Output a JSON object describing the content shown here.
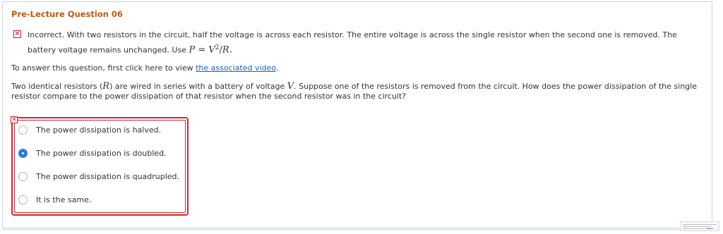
{
  "question": {
    "title": "Pre-Lecture Question 06",
    "feedback": {
      "icon": "x-mark-icon",
      "text_part1": "Incorrect. With two resistors in the circuit, half the voltage is across each resistor. The entire voltage is across the single resistor when the second one is removed. The battery voltage remains unchanged. Use ",
      "formula_P": "P",
      "formula_eq": " = ",
      "formula_V": "V",
      "formula_exp": "2",
      "formula_slash": "/",
      "formula_R": "R",
      "formula_end": "."
    },
    "instruction": {
      "prefix": "To answer this question, first click here to view ",
      "link_text": "the associated video",
      "suffix": "."
    },
    "prompt": {
      "part1": "Two identical resistors (",
      "R": "R",
      "part2": ") are wired in series with a battery of voltage ",
      "V": "V",
      "part3": ". Suppose one of the resistors is removed from the circuit. How does the power dissipation of the single resistor compare to the power dissipation of that resistor when the second resistor was in the circuit?"
    },
    "choices": [
      {
        "label": "The power dissipation is halved.",
        "selected": false
      },
      {
        "label": "The power dissipation is doubled.",
        "selected": true
      },
      {
        "label": "The power dissipation is quadrupled.",
        "selected": false
      },
      {
        "label": "It is the same.",
        "selected": false
      }
    ],
    "result": "incorrect"
  },
  "colors": {
    "title": "#b85a13",
    "error": "#d0252f",
    "link": "#1f5fa8",
    "radio_selected": "#2f7ed8"
  }
}
